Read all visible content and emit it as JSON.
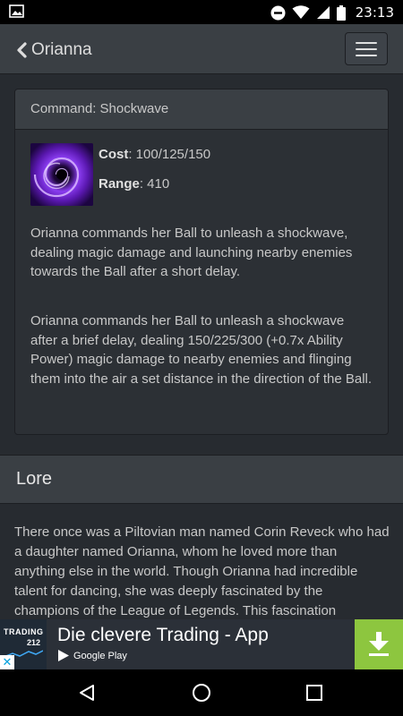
{
  "status_bar": {
    "time": "23:13",
    "icons": [
      "image-icon",
      "do-not-disturb-icon",
      "wifi-icon",
      "signal-icon",
      "battery-icon"
    ]
  },
  "app_bar": {
    "back_label": "Orianna",
    "icons": [
      "chevron-left-icon",
      "hamburger-menu-icon"
    ]
  },
  "ability": {
    "title": "Command: Shockwave",
    "icon": "shockwave-ability-icon",
    "cost_label": "Cost",
    "cost_value": ": 100/125/150",
    "range_label": "Range",
    "range_value": ": 410",
    "description_short": "Orianna commands her Ball to unleash a shockwave, dealing magic damage and launching nearby enemies towards the Ball after a short delay.",
    "description_long": "Orianna commands her Ball to unleash a shockwave after a brief delay, dealing 150/225/300 (+0.7x Ability Power) magic damage to nearby enemies and flinging them into the air a set distance in the direction of the Ball."
  },
  "lore": {
    "heading": "Lore",
    "text": "There once was a Piltovian man named Corin Reveck who had a daughter named Orianna, whom he loved more than anything else in the world. Though Orianna had incredible talent for dancing, she was deeply fascinated by the champions of the League of Legends. This fascination"
  },
  "ad": {
    "logo_line1": "TRADING",
    "logo_line2": "212",
    "title": "Die clevere Trading - App",
    "store_label": "Google Play",
    "close_glyph": "✕",
    "accent_color": "#8dc63f",
    "icons": [
      "google-play-icon",
      "download-icon"
    ]
  },
  "nav_bar": {
    "icons": [
      "back-triangle-icon",
      "home-circle-icon",
      "recents-square-icon"
    ]
  },
  "colors": {
    "background": "#272b30",
    "header": "#3a3f44",
    "border": "#1c1e22",
    "text": "#c8c8c8"
  }
}
